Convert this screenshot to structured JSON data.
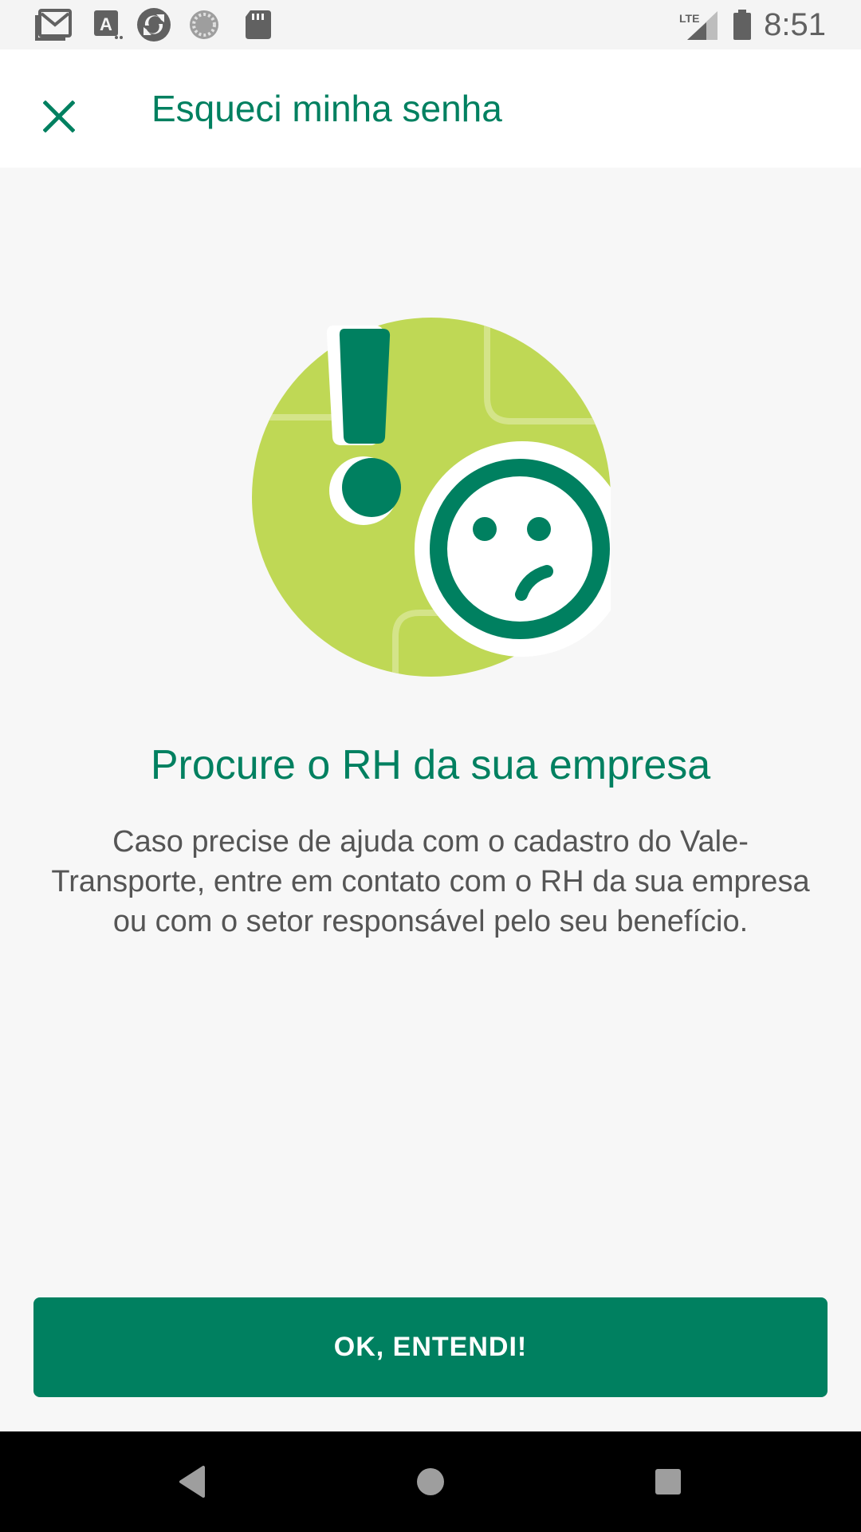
{
  "status_bar": {
    "time": "8:51",
    "network": "LTE",
    "notification_icons": [
      "gmail-icon",
      "a-app-icon",
      "sync-app-icon",
      "spinner-app-icon",
      "sd-card-icon"
    ]
  },
  "app_bar": {
    "title": "Esqueci minha senha",
    "close_icon": "close-icon"
  },
  "content": {
    "headline": "Procure o RH da sua empresa",
    "body": "Caso precise de ajuda com o cadastro do Vale-Transporte, entre em contato com o RH da sua empresa ou com o setor responsável pelo seu benefício.",
    "illustration": "exclamation-sad-face-illustration"
  },
  "actions": {
    "ok_label": "OK, ENTENDI!"
  },
  "nav_bar": {
    "icons": [
      "back-icon",
      "home-icon",
      "recents-icon"
    ]
  },
  "colors": {
    "primary": "#008060",
    "accent_light": "#bfd855",
    "background": "#f7f7f7",
    "body_text": "#555555"
  }
}
